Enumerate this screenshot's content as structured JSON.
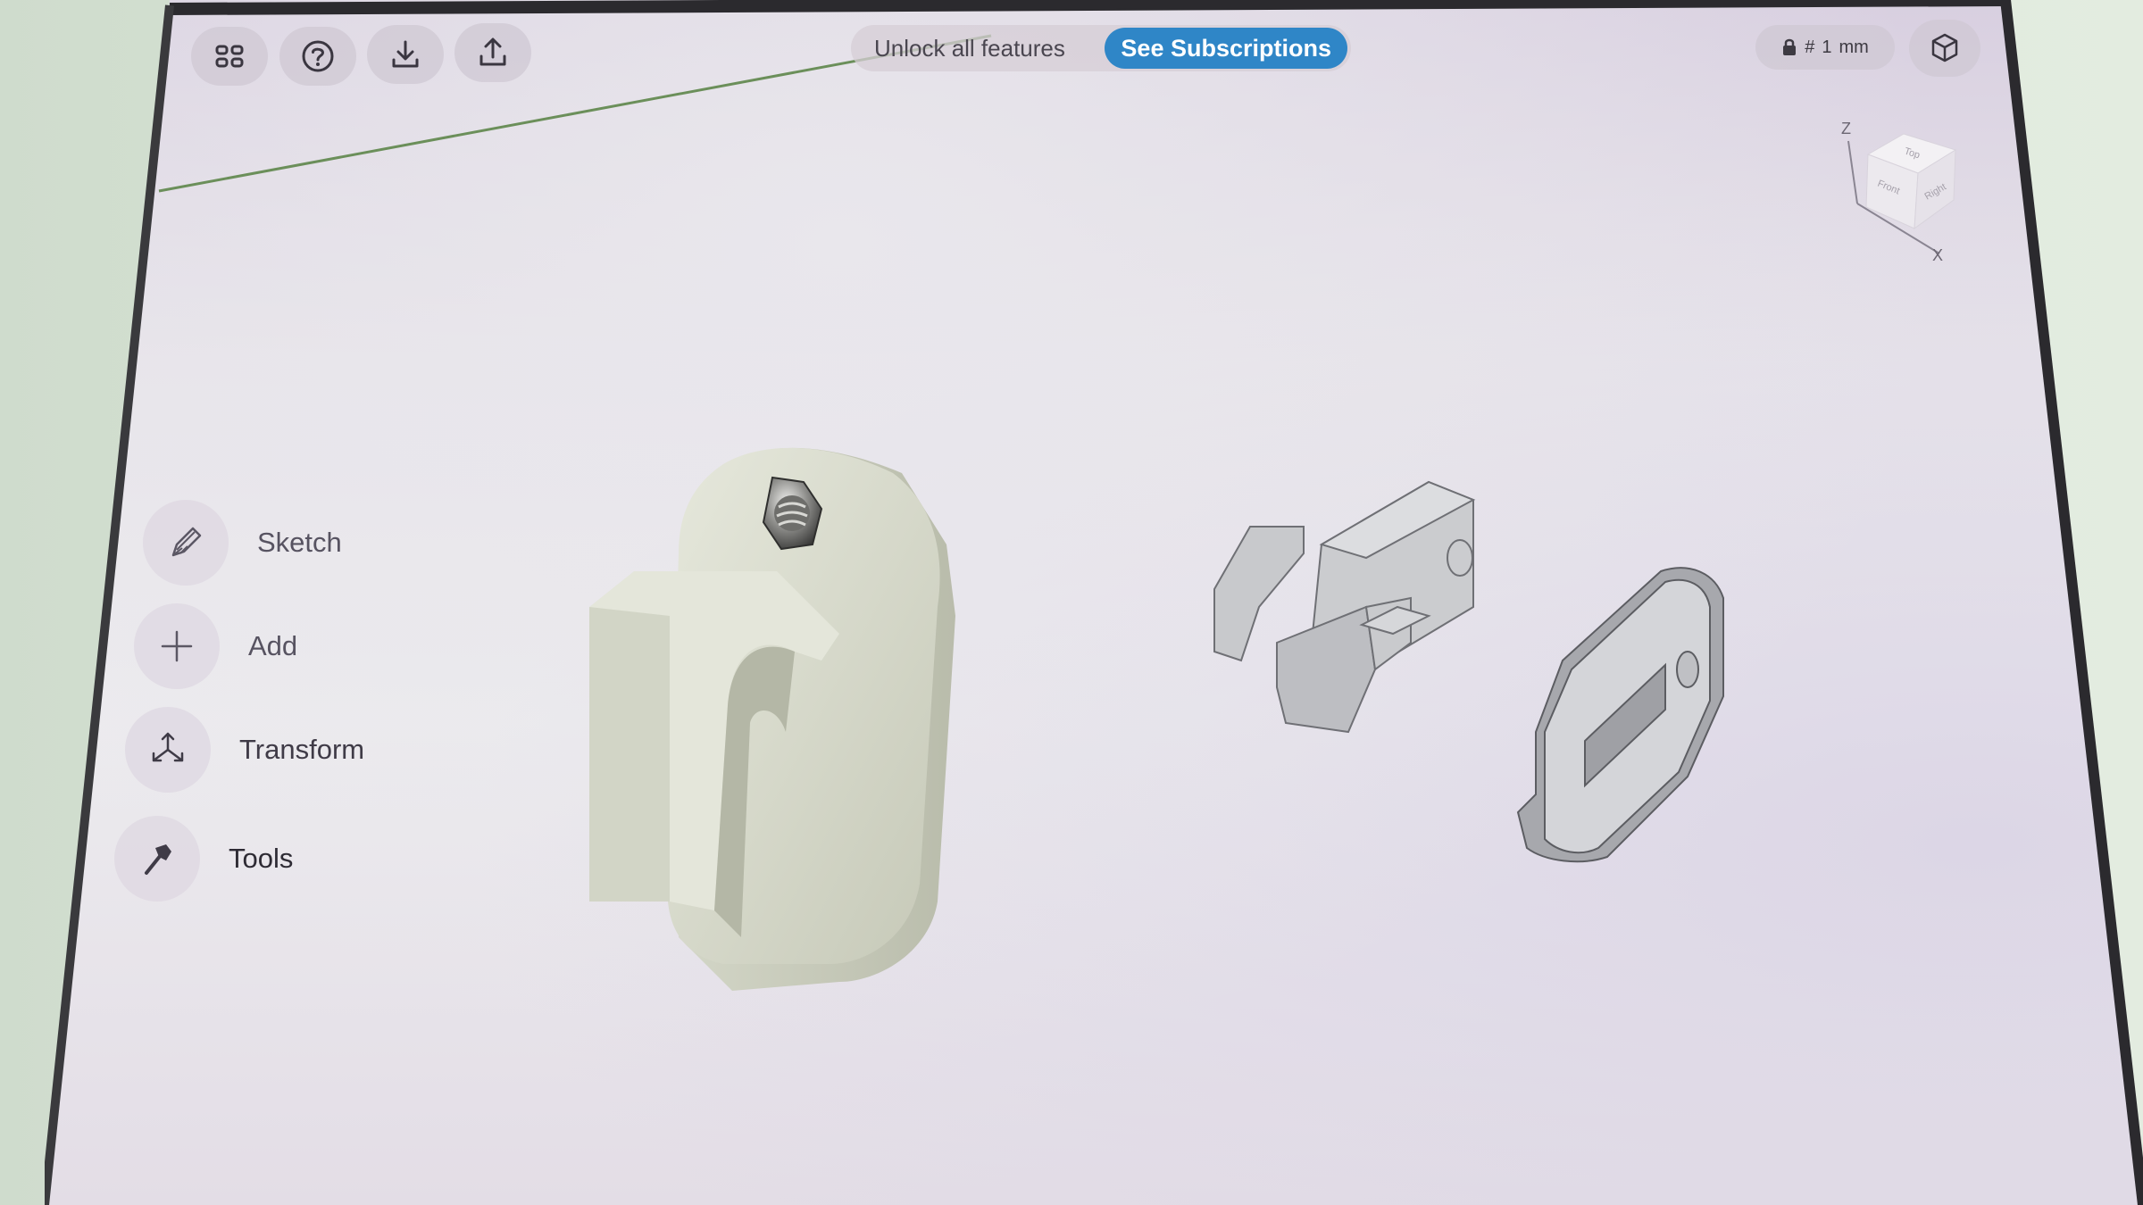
{
  "toolbar": {
    "icons": [
      "grid-icon",
      "help-icon",
      "download-icon",
      "share-icon"
    ]
  },
  "banner": {
    "unlock_text": "Unlock all features",
    "subscribe_label": "See Subscriptions"
  },
  "units": {
    "grid_symbol": "#",
    "value": "1",
    "unit": "mm"
  },
  "view_cube": {
    "faces": [
      "Top",
      "Front",
      "Right"
    ],
    "axes": [
      "Z",
      "X"
    ]
  },
  "side_menu": [
    {
      "label": "Sketch",
      "icon": "pencil-icon"
    },
    {
      "label": "Add",
      "icon": "plus-icon"
    },
    {
      "label": "Transform",
      "icon": "transform-arrows-icon"
    },
    {
      "label": "Tools",
      "icon": "hammer-icon"
    }
  ],
  "colors": {
    "accent": "#2f86c7",
    "panel": "#cec8d2",
    "text": "#575361"
  }
}
